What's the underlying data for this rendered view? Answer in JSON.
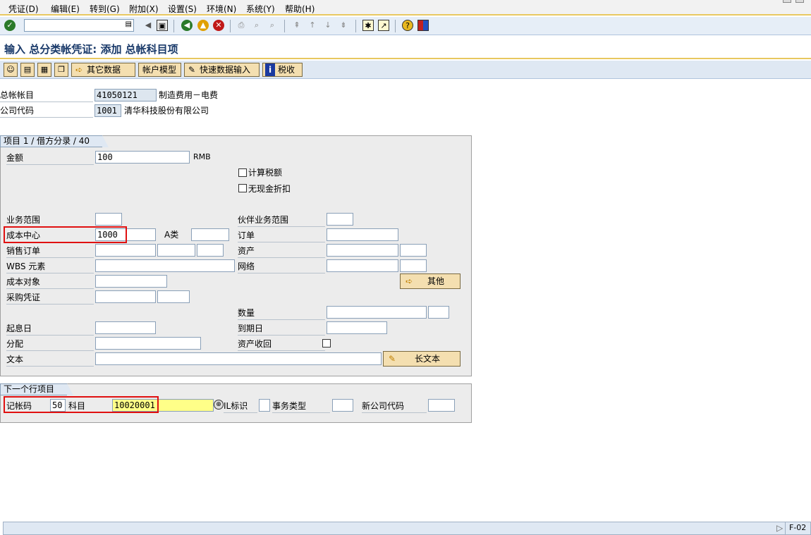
{
  "menu": {
    "items": [
      "凭证(D)",
      "编辑(E)",
      "转到(G)",
      "附加(X)",
      "设置(S)",
      "环境(N)",
      "系统(Y)",
      "帮助(H)"
    ]
  },
  "toolbar": {
    "command_value": "",
    "icons": [
      "check-icon",
      "save-icon",
      "back-icon",
      "exit-icon",
      "cancel-icon",
      "print-icon",
      "find-icon",
      "find-next-icon",
      "first-page-icon",
      "prev-page-icon",
      "next-page-icon",
      "last-page-icon",
      "new-session-icon",
      "shortcut-icon",
      "help-icon",
      "layout-icon"
    ]
  },
  "title": "输入 总分类帐凭证: 添加 总帐科目项",
  "app_toolbar": {
    "other_data": "其它数据",
    "account_model": "帐户模型",
    "fast_entry": "快速数据输入",
    "tax": "税收"
  },
  "header": {
    "gl_account_label": "总帐帐目",
    "gl_account_value": "41050121",
    "gl_account_desc": "制造费用－电费",
    "company_code_label": "公司代码",
    "company_code_value": "1001",
    "company_code_desc": "清华科技股份有限公司"
  },
  "item": {
    "title": "项目 1 / 借方分录 / 40",
    "amount_label": "金额",
    "amount_value": "100",
    "currency": "RMB",
    "calc_tax_label": "计算税额",
    "no_discount_label": "无现金折扣",
    "business_area_label": "业务范围",
    "partner_ba_label": "伙伴业务范围",
    "cost_center_label": "成本中心",
    "cost_center_value": "1000",
    "a_class_label": "A类",
    "order_label": "订单",
    "sales_order_label": "销售订单",
    "asset_label": "资产",
    "wbs_label": "WBS 元素",
    "network_label": "网络",
    "cost_object_label": "成本对象",
    "more_button": "其他",
    "po_label": "采购凭证",
    "quantity_label": "数量",
    "value_date_label": "起息日",
    "due_date_label": "到期日",
    "assignment_label": "分配",
    "asset_retirement_label": "资产收回",
    "text_label": "文本",
    "long_text_button": "长文本"
  },
  "next_item": {
    "title": "下一个行项目",
    "posting_key_label": "记帐码",
    "posting_key_value": "50",
    "account_label": "科目",
    "account_value": "10020001",
    "special_gl_label": "IL标识",
    "transaction_type_label": "事务类型",
    "new_company_code_label": "新公司代码"
  },
  "status": {
    "transaction": "F-02"
  }
}
